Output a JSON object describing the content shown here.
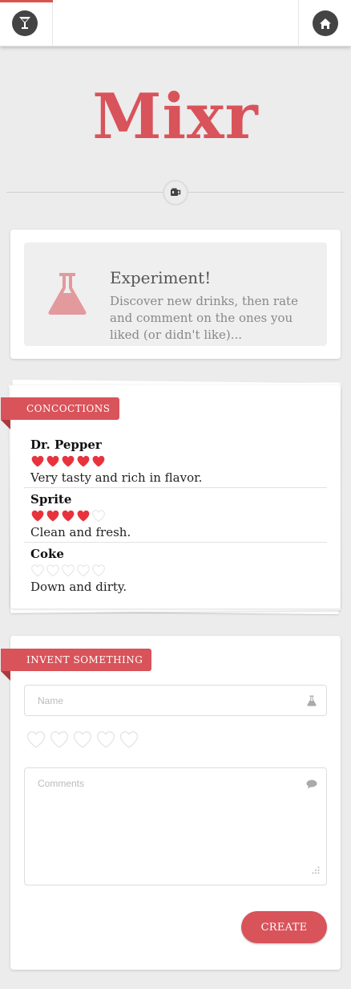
{
  "topbar": {
    "left_icon": "cocktail-glass-icon",
    "right_icon": "home-icon",
    "accent": "#d9534f"
  },
  "logo": {
    "text": "Mixr",
    "color": "#d9535a"
  },
  "divider_icon": "mug-icon",
  "experiment": {
    "icon": "flask-icon",
    "title": "Experiment!",
    "description": "Discover new drinks, then rate and comment on the ones you liked (or didn't like)..."
  },
  "concoctions": {
    "label": "CONCOCTIONS",
    "items": [
      {
        "name": "Dr. Pepper",
        "rating": 5,
        "max_rating": 5,
        "comment": "Very tasty and rich in flavor."
      },
      {
        "name": "Sprite",
        "rating": 4,
        "max_rating": 5,
        "comment": "Clean and fresh."
      },
      {
        "name": "Coke",
        "rating": 0,
        "max_rating": 5,
        "comment": "Down and dirty."
      }
    ]
  },
  "invent": {
    "label": "INVENT SOMETHING",
    "name_placeholder": "Name",
    "name_value": "",
    "name_icon": "flask-icon",
    "rating": 0,
    "max_rating": 5,
    "comments_placeholder": "Comments",
    "comments_value": "",
    "comments_icon": "speech-bubble-icon",
    "create_label": "CREATE"
  },
  "colors": {
    "heart_filled": "#e8333d",
    "heart_empty": "#e3e3e3",
    "brand": "#d9535a"
  }
}
